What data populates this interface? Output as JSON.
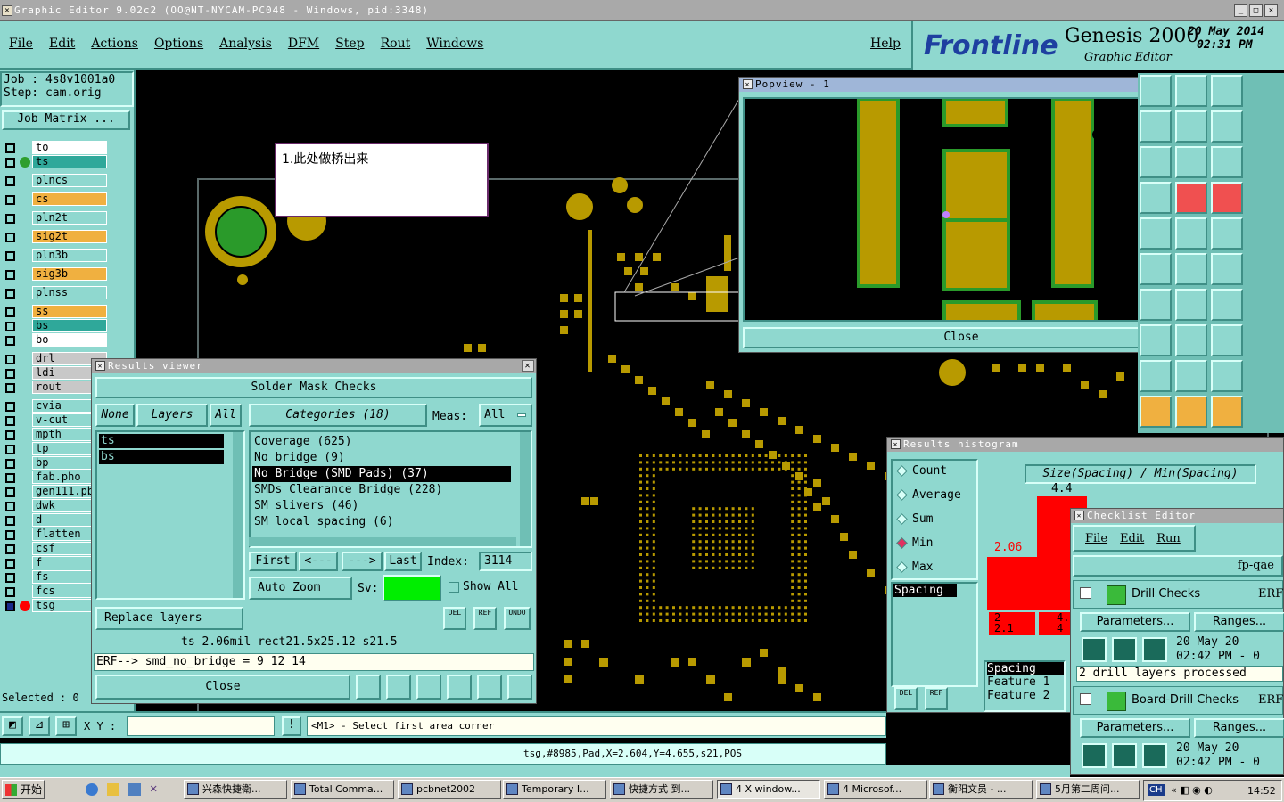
{
  "window": {
    "title": "Graphic Editor 9.02c2 (OO@NT-NYCAM-PC048 - Windows, pid:3348)"
  },
  "menu": [
    "File",
    "Edit",
    "Actions",
    "Options",
    "Analysis",
    "DFM",
    "Step",
    "Rout",
    "Windows"
  ],
  "help_label": "Help",
  "brand": {
    "logo": "Frontline",
    "product": "Genesis 2000",
    "subtitle": "Graphic Editor",
    "date": "20 May 2014",
    "time": "02:31 PM"
  },
  "job": {
    "job_label": "Job : 4s8v1001a0",
    "step_label": "Step: cam.orig",
    "matrix_button": "Job Matrix ..."
  },
  "layers": [
    {
      "name": "to",
      "color": "#ffffff"
    },
    {
      "name": "ts",
      "color": "#2fa89a"
    },
    {
      "name": "plncs",
      "color": "#8fd8cf"
    },
    {
      "name": "cs",
      "color": "#f0b040"
    },
    {
      "name": "pln2t",
      "color": "#8fd8cf"
    },
    {
      "name": "sig2t",
      "color": "#f0b040"
    },
    {
      "name": "pln3b",
      "color": "#8fd8cf"
    },
    {
      "name": "sig3b",
      "color": "#f0b040"
    },
    {
      "name": "plnss",
      "color": "#8fd8cf"
    },
    {
      "name": "ss",
      "color": "#f0b040"
    },
    {
      "name": "bs",
      "color": "#2fa89a"
    },
    {
      "name": "bo",
      "color": "#ffffff"
    },
    {
      "name": "drl",
      "color": "#c8c8c8"
    },
    {
      "name": "ldi",
      "color": "#c8c8c8"
    },
    {
      "name": "rout",
      "color": "#c8c8c8"
    },
    {
      "name": "cvia",
      "color": "#8fd8cf"
    },
    {
      "name": "v-cut",
      "color": "#8fd8cf"
    },
    {
      "name": "mpth",
      "color": "#8fd8cf"
    },
    {
      "name": "tp",
      "color": "#8fd8cf"
    },
    {
      "name": "bp",
      "color": "#8fd8cf"
    },
    {
      "name": "fab.pho",
      "color": "#8fd8cf"
    },
    {
      "name": "gen111.pb",
      "color": "#8fd8cf"
    },
    {
      "name": "dwk",
      "color": "#8fd8cf"
    },
    {
      "name": "d",
      "color": "#8fd8cf"
    },
    {
      "name": "flatten",
      "color": "#8fd8cf"
    },
    {
      "name": "csf",
      "color": "#8fd8cf"
    },
    {
      "name": "f",
      "color": "#8fd8cf"
    },
    {
      "name": "fs",
      "color": "#8fd8cf"
    },
    {
      "name": "fcs",
      "color": "#8fd8cf"
    },
    {
      "name": "tsg",
      "color": "#8fd8cf"
    }
  ],
  "selected_label": "Selected : 0",
  "note_text": "1.此处做桥出来",
  "popview": {
    "title": "Popview - 1",
    "close": "Close"
  },
  "results_viewer": {
    "title": "Results viewer",
    "header": "Solder Mask Checks",
    "none_btn": "None",
    "layers_btn": "Layers",
    "all_btn": "All",
    "categories_label": "Categories (18)",
    "meas_label": "Meas:",
    "meas_value": "All",
    "layer_list": [
      "ts",
      "bs"
    ],
    "categories": [
      "Coverage (625)",
      "No bridge (9)",
      "No Bridge (SMD Pads) (37)",
      "SMDs Clearance Bridge (228)",
      "SM slivers (46)",
      "SM local spacing (6)"
    ],
    "selected_category_index": 2,
    "nav": {
      "first": "First",
      "prev": "<---",
      "next": "--->",
      "last": "Last",
      "index_label": "Index:",
      "index_value": "3114"
    },
    "auto_zoom": "Auto Zoom",
    "sv_label": "Sv:",
    "show_all": "Show All",
    "replace_layers": "Replace layers",
    "icons": {
      "del": "DEL",
      "ref": "REF",
      "undo": "UNDO"
    },
    "status": "ts 2.06mil  rect21.5x25.12  s21.5",
    "erf": "ERF--> smd_no_bridge = 9 12 14",
    "close": "Close"
  },
  "histogram": {
    "title": "Results histogram",
    "options": [
      "Count",
      "Average",
      "Sum",
      "Min",
      "Max"
    ],
    "selected_option": "Min",
    "chart_title": "Size(Spacing) / Min(Spacing)",
    "bar_labels": [
      "2.06",
      "4.4"
    ],
    "range_labels": [
      "2-",
      "2.1",
      "4.4",
      "4"
    ],
    "list_item": "Spacing",
    "detail": [
      "Spacing",
      "Feature 1",
      "Feature 2"
    ],
    "del": "DEL",
    "ref": "REF"
  },
  "checklist": {
    "title": "Checklist Editor",
    "menu": [
      "File",
      "Edit",
      "Run"
    ],
    "name": "fp-qae",
    "checks": [
      {
        "name": "Drill Checks",
        "erf": "ERF",
        "params": "Parameters...",
        "ranges": "Ranges...",
        "date": "20 May 20",
        "time": "02:42 PM - 0",
        "msg": "2 drill layers processed"
      },
      {
        "name": "Board-Drill Checks",
        "erf": "ERF",
        "params": "Parameters...",
        "ranges": "Ranges...",
        "date": "20 May 20",
        "time": "02:42 PM - 0"
      }
    ]
  },
  "bottom": {
    "xy_label": "X Y :",
    "prompt": "<M1> - Select first area corner",
    "status": "tsg,#8985,Pad,X=2.604,Y=4.655,s21,POS"
  },
  "taskbar": {
    "start": "开始",
    "items": [
      "兴森快捷衛...",
      "Total Comma...",
      "pcbnet2002",
      "Temporary I...",
      "快捷方式 到...",
      "4 X window...",
      "4 Microsof...",
      "衡阳文员 - ...",
      "5月第二周问..."
    ],
    "clock": "14:52",
    "tray": "CH"
  },
  "colors": {
    "panel": "#8fd8cf",
    "copper": "#b89a00",
    "mask": "#2e9e2e",
    "red": "#ff0000"
  }
}
